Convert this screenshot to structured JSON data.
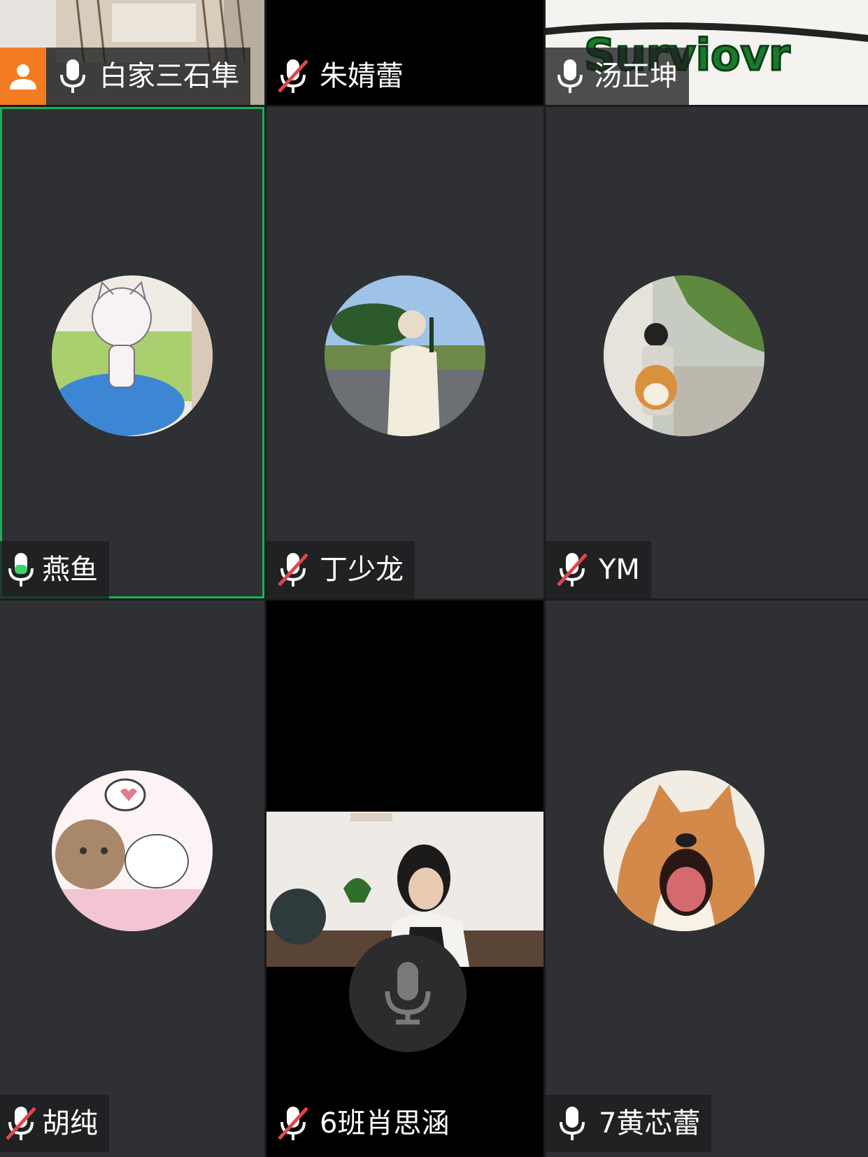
{
  "participants": [
    {
      "name": "白家三石隼",
      "mic": "on",
      "video": "on",
      "camera_badge": "person-icon"
    },
    {
      "name": "朱婧蕾",
      "mic": "muted",
      "video": "off"
    },
    {
      "name": "汤正坤",
      "mic": "on",
      "video": "on",
      "video_text": "Surviovr"
    },
    {
      "name": "燕鱼",
      "mic": "speaking",
      "video": "off",
      "active_speaker": true
    },
    {
      "name": "丁少龙",
      "mic": "muted",
      "video": "off"
    },
    {
      "name": "YM",
      "mic": "muted",
      "video": "off"
    },
    {
      "name": "胡纯",
      "mic": "muted",
      "video": "off"
    },
    {
      "name": "6班肖思涵",
      "mic": "muted",
      "video": "on"
    },
    {
      "name": "7黄芯蕾",
      "mic": "on",
      "video": "off"
    }
  ],
  "colors": {
    "tile_bg": "#2e3033",
    "active_border": "#19b257",
    "muted_slash": "#e0484a",
    "camera_badge": "#f37b22",
    "speaking_level": "#3fd26a"
  }
}
